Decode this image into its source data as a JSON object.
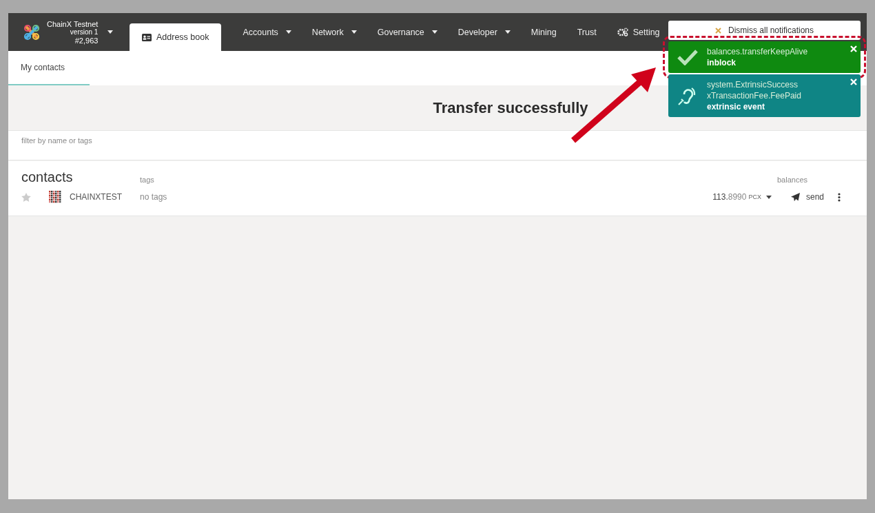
{
  "chain": {
    "name": "ChainX Testnet",
    "version": "version 1",
    "block": "#2,963"
  },
  "nav": [
    {
      "label": "Address book",
      "selected": true,
      "dropdown": false
    },
    {
      "label": "Accounts",
      "selected": false,
      "dropdown": true
    },
    {
      "label": "Network",
      "selected": false,
      "dropdown": true
    },
    {
      "label": "Governance",
      "selected": false,
      "dropdown": true
    },
    {
      "label": "Developer",
      "selected": false,
      "dropdown": true
    },
    {
      "label": "Mining",
      "selected": false,
      "dropdown": false
    },
    {
      "label": "Trust",
      "selected": false,
      "dropdown": false
    },
    {
      "label": "Setting",
      "selected": false,
      "dropdown": false
    }
  ],
  "subtabs": [
    {
      "label": "My contacts",
      "selected": true
    }
  ],
  "annotation": "Transfer successfully",
  "filter": {
    "placeholder": "filter by name or tags"
  },
  "contacts": {
    "title": "contacts",
    "columns": [
      "tags",
      "balances"
    ],
    "rows": [
      {
        "starred": false,
        "name": "CHAINXTEST",
        "tags": "no tags",
        "balance_int": "113.",
        "balance_dec": "8990",
        "unit": "PCX",
        "action": "send"
      }
    ]
  },
  "notifications": {
    "dismiss": "Dismiss all notifications",
    "items": [
      {
        "kind": "success",
        "lines": [
          "balances.transferKeepAlive"
        ],
        "status": "inblock",
        "highlighted": true
      },
      {
        "kind": "event",
        "lines": [
          "system.ExtrinsicSuccess",
          "xTransactionFee.FeePaid"
        ],
        "status": "extrinsic event",
        "highlighted": false
      }
    ]
  }
}
